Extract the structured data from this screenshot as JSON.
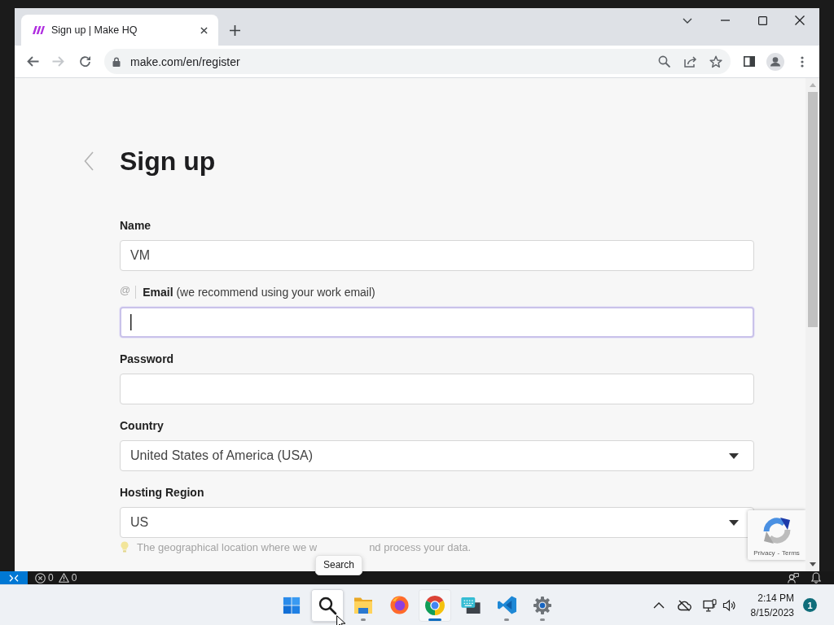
{
  "browser": {
    "tabs": [
      {
        "title": "Sign up | Make HQ",
        "selected": true
      }
    ],
    "toolbar": {
      "back": {
        "disabled": false
      },
      "forward": {
        "disabled": true
      }
    },
    "address_bar": {
      "url": "make.com/en/register"
    }
  },
  "page": {
    "heading": "Sign up",
    "fields": [
      {
        "kind": "text",
        "label": "Name",
        "value": "VM",
        "focused": false
      },
      {
        "kind": "email",
        "prefix": "@",
        "label": "Email",
        "note": "(we recommend using your work email)",
        "focused": true
      },
      {
        "kind": "password",
        "label": "Password",
        "focused": false
      },
      {
        "kind": "select",
        "label": "Country",
        "value": "United States of America (USA)",
        "focused": false
      },
      {
        "kind": "select",
        "label": "Hosting Region",
        "value": "US",
        "focused": false,
        "hint": [
          "The geographical location where we w",
          "nd process your data."
        ]
      }
    ],
    "recaptcha": {
      "links": [
        "Privacy",
        "Terms"
      ],
      "separator": "-"
    }
  },
  "status_bar": {
    "errors": "0",
    "warnings": "0"
  },
  "taskbar": {
    "apps": [
      {
        "kind": "start",
        "running": false,
        "selected": false,
        "hovered": false
      },
      {
        "kind": "search",
        "running": false,
        "selected": false,
        "hovered": true,
        "tooltip": "Search"
      },
      {
        "kind": "folder",
        "running": true,
        "selected": false,
        "hovered": false
      },
      {
        "kind": "fox",
        "running": false,
        "selected": false,
        "hovered": false
      },
      {
        "kind": "ring",
        "running": true,
        "selected": true,
        "hovered": false
      },
      {
        "kind": "keyboard",
        "running": false,
        "selected": false,
        "hovered": false
      },
      {
        "kind": "ribbon",
        "running": true,
        "selected": false,
        "hovered": false
      },
      {
        "kind": "gear",
        "running": true,
        "selected": false,
        "hovered": false
      }
    ],
    "tray": {
      "time": "2:14 PM",
      "date": "8/15/2023",
      "notifications": "1"
    }
  }
}
